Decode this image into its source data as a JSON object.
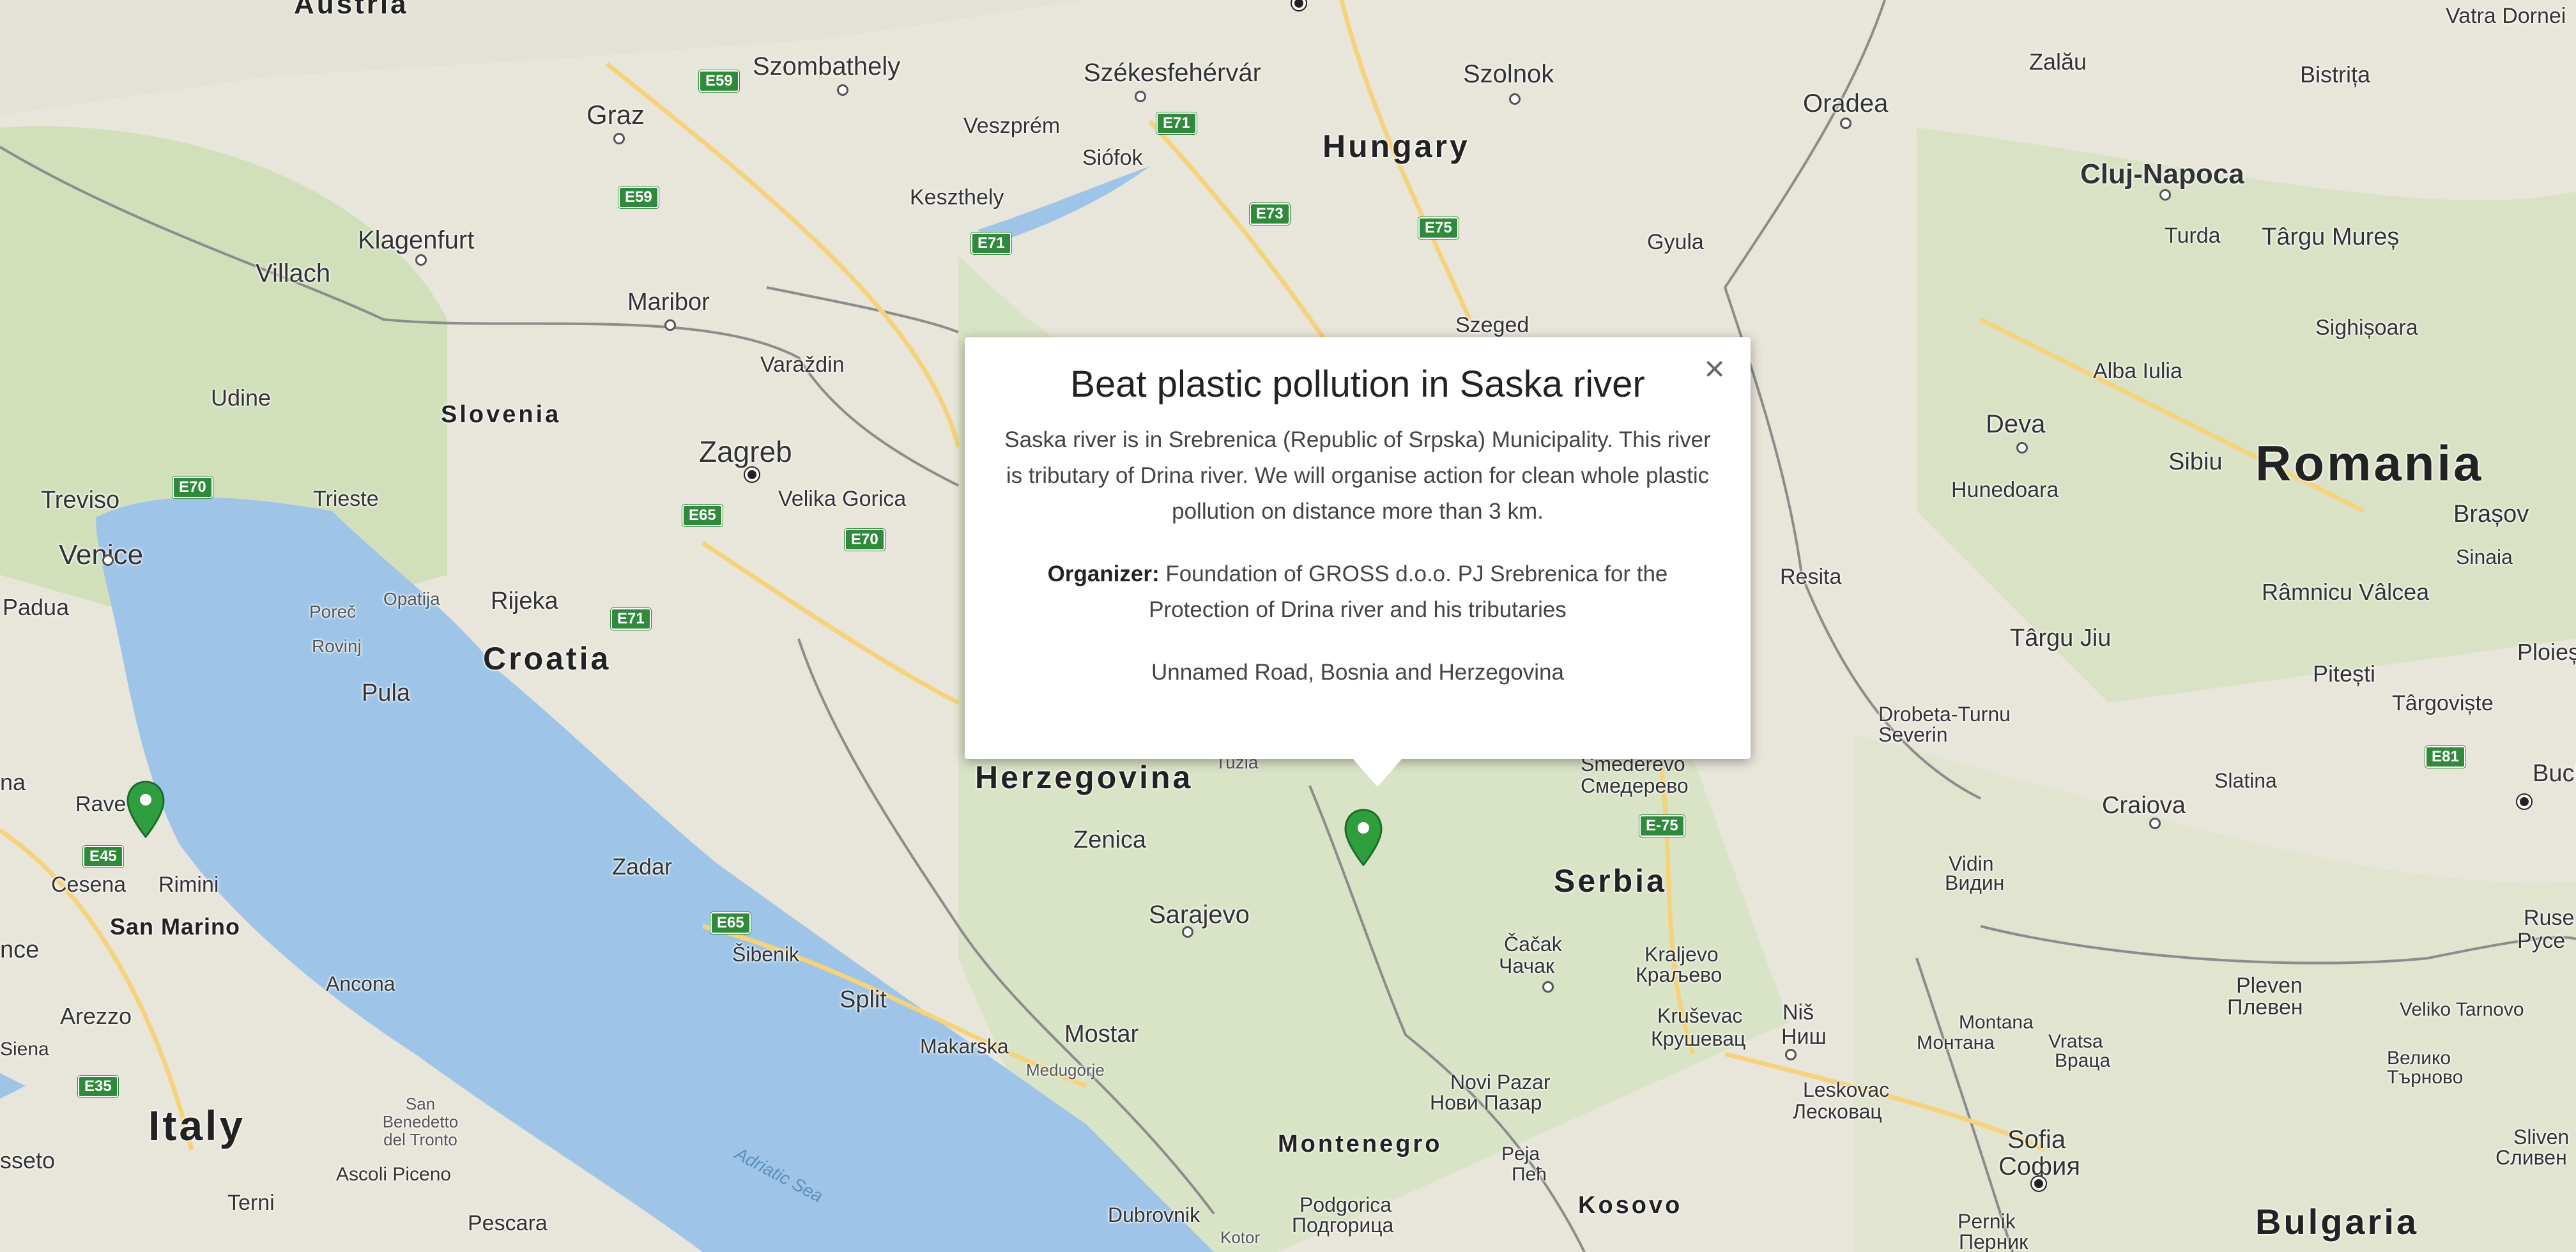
{
  "map": {
    "countries": [
      {
        "id": "austria",
        "label": "Austria"
      },
      {
        "id": "hungary",
        "label": "Hungary"
      },
      {
        "id": "slovenia",
        "label": "Slovenia"
      },
      {
        "id": "croatia",
        "label": "Croatia"
      },
      {
        "id": "romania",
        "label": "Romania"
      },
      {
        "id": "serbia",
        "label": "Serbia"
      },
      {
        "id": "italy",
        "label": "Italy"
      },
      {
        "id": "montenegro",
        "label": "Montenegro"
      },
      {
        "id": "kosovo",
        "label": "Kosovo"
      },
      {
        "id": "bulgaria",
        "label": "Bulgaria"
      },
      {
        "id": "herzegovina",
        "label": "Herzegovina"
      },
      {
        "id": "san-marino",
        "label": "San Marino"
      }
    ],
    "cities": [
      {
        "id": "szombathely",
        "label": "Szombathely"
      },
      {
        "id": "szekesfehervar",
        "label": "Székesfehérvár"
      },
      {
        "id": "szolnok",
        "label": "Szolnok"
      },
      {
        "id": "oradea",
        "label": "Oradea"
      },
      {
        "id": "zalau",
        "label": "Zalău"
      },
      {
        "id": "bistrita",
        "label": "Bistrița"
      },
      {
        "id": "vatra-dornei",
        "label": "Vatra Dornei"
      },
      {
        "id": "graz",
        "label": "Graz"
      },
      {
        "id": "veszprem",
        "label": "Veszprém"
      },
      {
        "id": "siofok",
        "label": "Siófok"
      },
      {
        "id": "keszthely",
        "label": "Keszthely"
      },
      {
        "id": "cluj-napoca",
        "label": "Cluj-Napoca"
      },
      {
        "id": "klagenfurt",
        "label": "Klagenfurt"
      },
      {
        "id": "villach",
        "label": "Villach"
      },
      {
        "id": "maribor",
        "label": "Maribor"
      },
      {
        "id": "gyula",
        "label": "Gyula"
      },
      {
        "id": "turda",
        "label": "Turda"
      },
      {
        "id": "targu-mures",
        "label": "Târgu Mureș"
      },
      {
        "id": "sighisoara",
        "label": "Sighișoara"
      },
      {
        "id": "szeged",
        "label": "Szeged"
      },
      {
        "id": "varazdin",
        "label": "Varaždin"
      },
      {
        "id": "alba-iulia",
        "label": "Alba Iulia"
      },
      {
        "id": "udine",
        "label": "Udine"
      },
      {
        "id": "zagreb",
        "label": "Zagreb"
      },
      {
        "id": "velika-gorica",
        "label": "Velika Gorica"
      },
      {
        "id": "deva",
        "label": "Deva"
      },
      {
        "id": "hunedoara",
        "label": "Hunedoara"
      },
      {
        "id": "sibiu",
        "label": "Sibiu"
      },
      {
        "id": "treviso",
        "label": "Treviso"
      },
      {
        "id": "trieste",
        "label": "Trieste"
      },
      {
        "id": "brasov",
        "label": "Brașov"
      },
      {
        "id": "venice",
        "label": "Venice"
      },
      {
        "id": "sinaia",
        "label": "Sinaia"
      },
      {
        "id": "padua",
        "label": "Padua"
      },
      {
        "id": "opatija",
        "label": "Opatija"
      },
      {
        "id": "rijeka",
        "label": "Rijeka"
      },
      {
        "id": "resita",
        "label": "Resita"
      },
      {
        "id": "ramnicu-valcea",
        "label": "Râmnicu Vâlcea"
      },
      {
        "id": "porec",
        "label": "Poreč"
      },
      {
        "id": "rovinj",
        "label": "Rovinj"
      },
      {
        "id": "targu-jiu",
        "label": "Târgu Jiu"
      },
      {
        "id": "pitesti",
        "label": "Pitești"
      },
      {
        "id": "ploiesti",
        "label": "Ploieș"
      },
      {
        "id": "targoviste",
        "label": "Târgoviște"
      },
      {
        "id": "pula",
        "label": "Pula"
      },
      {
        "id": "drobeta",
        "label": "Drobeta-Turnu Severin"
      },
      {
        "id": "tuzla",
        "label": "Tuzla"
      },
      {
        "id": "smederevo",
        "label": "Smederevo"
      },
      {
        "id": "smederevo-cyr",
        "label": "Смедерево"
      },
      {
        "id": "ravenna",
        "label": "Rave"
      },
      {
        "id": "slatina",
        "label": "Slatina"
      },
      {
        "id": "bucharest",
        "label": "Buchar"
      },
      {
        "id": "craiova",
        "label": "Craiova"
      },
      {
        "id": "zenica",
        "label": "Zenica"
      },
      {
        "id": "cesena",
        "label": "Cesena"
      },
      {
        "id": "rimini",
        "label": "Rimini"
      },
      {
        "id": "vidin",
        "label": "Vidin"
      },
      {
        "id": "vidin-cyr",
        "label": "Видин"
      },
      {
        "id": "zadar",
        "label": "Zadar"
      },
      {
        "id": "sarajevo",
        "label": "Sarajevo"
      },
      {
        "id": "ruse",
        "label": "Ruse"
      },
      {
        "id": "ruse-cyr",
        "label": "Русе"
      },
      {
        "id": "cacak",
        "label": "Čačak"
      },
      {
        "id": "cacak-cyr",
        "label": "Чачак"
      },
      {
        "id": "kraljevo",
        "label": "Kraljevo"
      },
      {
        "id": "kraljevo-cyr",
        "label": "Краљево"
      },
      {
        "id": "sibenik",
        "label": "Šibenik"
      },
      {
        "id": "ancona",
        "label": "Ancona"
      },
      {
        "id": "pleven",
        "label": "Pleven"
      },
      {
        "id": "pleven-cyr",
        "label": "Плевен"
      },
      {
        "id": "split",
        "label": "Split"
      },
      {
        "id": "arezzo",
        "label": "Arezzo"
      },
      {
        "id": "krusevac",
        "label": "Kruševac"
      },
      {
        "id": "krusevac-cyr",
        "label": "Крушевац"
      },
      {
        "id": "nis",
        "label": "Niš"
      },
      {
        "id": "nis-cyr",
        "label": "Ниш"
      },
      {
        "id": "montana",
        "label": "Montana"
      },
      {
        "id": "montana-cyr",
        "label": "Монтана"
      },
      {
        "id": "vratsa",
        "label": "Vratsa"
      },
      {
        "id": "vratsa-cyr",
        "label": "Враца"
      },
      {
        "id": "veliko-tarnovo",
        "label": "Veliko Tarnovo"
      },
      {
        "id": "veliko-tarnovo-cyr",
        "label": "Велико Търново"
      },
      {
        "id": "makarska",
        "label": "Makarska"
      },
      {
        "id": "mostar",
        "label": "Mostar"
      },
      {
        "id": "medugorje",
        "label": "Medugorje"
      },
      {
        "id": "siena",
        "label": "Siena"
      },
      {
        "id": "novi-pazar",
        "label": "Novi Pazar"
      },
      {
        "id": "novi-pazar-cyr",
        "label": "Нови Пазар"
      },
      {
        "id": "leskovac",
        "label": "Leskovac"
      },
      {
        "id": "leskovac-cyr",
        "label": "Лесковац"
      },
      {
        "id": "san-benedetto",
        "label": "San Benedetto del Tronto"
      },
      {
        "id": "sofia",
        "label": "Sofia"
      },
      {
        "id": "sofia-cyr",
        "label": "София"
      },
      {
        "id": "sliven",
        "label": "Sliven"
      },
      {
        "id": "sliven-cyr",
        "label": "Сливен"
      },
      {
        "id": "peja",
        "label": "Peja"
      },
      {
        "id": "peja-cyr",
        "label": "Пећ"
      },
      {
        "id": "grosseto",
        "label": "sseto"
      },
      {
        "id": "ascoli",
        "label": "Ascoli Piceno"
      },
      {
        "id": "terni",
        "label": "Terni"
      },
      {
        "id": "pescara",
        "label": "Pescara"
      },
      {
        "id": "dubrovnik",
        "label": "Dubrovnik"
      },
      {
        "id": "kotor",
        "label": "Kotor"
      },
      {
        "id": "podgorica",
        "label": "Podgorica"
      },
      {
        "id": "podgorica-cyr",
        "label": "Подгорица"
      },
      {
        "id": "pernik",
        "label": "Pernik"
      },
      {
        "id": "pernik-cyr",
        "label": "Перник"
      },
      {
        "id": "florence",
        "label": "nce"
      },
      {
        "id": "ravenna-na",
        "label": "na"
      }
    ],
    "seas": [
      {
        "id": "adriatic",
        "label": "Adriatic Sea"
      }
    ],
    "roads": [
      "E59",
      "E71",
      "E73",
      "E75",
      "E59",
      "E71",
      "E70",
      "E65",
      "E70",
      "E71",
      "E45",
      "E65",
      "E35",
      "E81",
      "E-75"
    ]
  },
  "popup": {
    "title": "Beat plastic pollution in Saska river",
    "description": "Saska river is in Srebrenica (Republic of Srpska) Municipality. This river is tributary of Drina river. We will organise action for clean whole plastic pollution on distance more than 3 km.",
    "organizer_label": "Organizer:",
    "organizer_value": "Foundation of GROSS d.o.o. PJ Srebrenica for the Protection of Drina river and his tributaries",
    "address": "Unnamed Road, Bosnia and Herzegovina",
    "close_symbol": "×"
  },
  "markers": [
    {
      "id": "marker-saska",
      "color": "#2e9e3e"
    },
    {
      "id": "marker-italy",
      "color": "#2e9e3e"
    }
  ]
}
